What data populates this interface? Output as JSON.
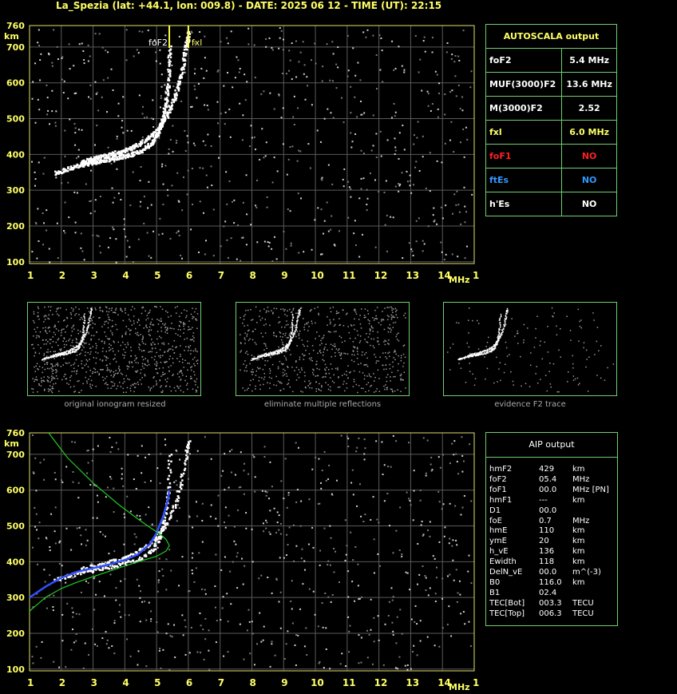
{
  "header": {
    "title": "La_Spezia (lat: +44.1, lon: 009.8) - DATE: 2025 06 12 - TIME (UT): 22:15"
  },
  "axis": {
    "y_unit": "km",
    "x_unit": "MHz",
    "y_ticks": [
      "760",
      "700",
      "600",
      "500",
      "400",
      "300",
      "200",
      "100"
    ],
    "x_ticks": [
      "1",
      "2",
      "3",
      "4",
      "5",
      "6",
      "7",
      "8",
      "9",
      "10",
      "11",
      "12",
      "13",
      "14",
      "15"
    ]
  },
  "markers": {
    "fof2_label": "foF2",
    "fxl_label": "fxl"
  },
  "autoscala": {
    "title": "AUTOSCALA output",
    "rows": [
      {
        "label": "foF2",
        "value": "5.4 MHz",
        "label_color": "#ffffff",
        "value_color": "#ffffff"
      },
      {
        "label": "MUF(3000)F2",
        "value": "13.6 MHz",
        "label_color": "#ffffff",
        "value_color": "#ffffff"
      },
      {
        "label": "M(3000)F2",
        "value": "2.52",
        "label_color": "#ffffff",
        "value_color": "#ffffff"
      },
      {
        "label": "fxl",
        "value": "6.0 MHz",
        "label_color": "#ffff66",
        "value_color": "#ffff66"
      },
      {
        "label": "foF1",
        "value": "NO",
        "label_color": "#ff2020",
        "value_color": "#ff2020"
      },
      {
        "label": "ftEs",
        "value": "NO",
        "label_color": "#3399ff",
        "value_color": "#3399ff"
      },
      {
        "label": "h'Es",
        "value": "NO",
        "label_color": "#ffffff",
        "value_color": "#ffffff"
      }
    ]
  },
  "thumbnails": [
    {
      "caption": "original ionogram resized"
    },
    {
      "caption": "eliminate multiple reflections"
    },
    {
      "caption": "evidence F2 trace"
    }
  ],
  "aip": {
    "title": "AIP output",
    "rows": [
      {
        "name": "hmF2",
        "value": "429",
        "unit": "km"
      },
      {
        "name": "foF2",
        "value": "05.4",
        "unit": "MHz"
      },
      {
        "name": "foF1",
        "value": "00.0",
        "unit": "MHz   [PN]"
      },
      {
        "name": "hmF1",
        "value": "---",
        "unit": "km"
      },
      {
        "name": "D1",
        "value": "00.0",
        "unit": ""
      },
      {
        "name": "foE",
        "value": "0.7",
        "unit": "MHz"
      },
      {
        "name": "hmE",
        "value": "110",
        "unit": "km"
      },
      {
        "name": "ymE",
        "value": "20",
        "unit": "km"
      },
      {
        "name": "h_vE",
        "value": "136",
        "unit": "km"
      },
      {
        "name": "Ewidth",
        "value": "118",
        "unit": "km"
      },
      {
        "name": "DelN_vE",
        "value": "00.0",
        "unit": "m^(-3)"
      },
      {
        "name": "B0",
        "value": "116.0",
        "unit": "km"
      },
      {
        "name": "B1",
        "value": "02.4",
        "unit": ""
      },
      {
        "name": "TEC[Bot]",
        "value": "003.3",
        "unit": "TECU"
      },
      {
        "name": "TEC[Top]",
        "value": "006.3",
        "unit": "TECU"
      }
    ]
  },
  "chart_data": [
    {
      "type": "scatter",
      "title": "",
      "xlabel": "MHz",
      "ylabel": "km",
      "xlim": [
        1,
        15
      ],
      "ylim": [
        95,
        760
      ],
      "grid": true,
      "series": [
        {
          "x": [
            1.8,
            2.2,
            2.6,
            3.0,
            3.4,
            3.8,
            4.2,
            4.6,
            4.9,
            5.1,
            5.25,
            5.35,
            5.4
          ],
          "y": [
            350,
            362,
            372,
            380,
            387,
            394,
            402,
            416,
            440,
            475,
            530,
            600,
            700
          ]
        },
        {
          "x": [
            2.6,
            3.0,
            3.4,
            3.8,
            4.2,
            4.6,
            5.0,
            5.3,
            5.55,
            5.75,
            5.9,
            6.0
          ],
          "y": [
            380,
            390,
            398,
            408,
            420,
            440,
            470,
            510,
            560,
            620,
            700,
            740
          ]
        }
      ],
      "markers": [
        {
          "x": 5.4
        },
        {
          "x": 6.0
        }
      ]
    },
    {
      "type": "line",
      "title": "",
      "xlabel": "MHz",
      "ylabel": "km",
      "xlim": [
        1,
        15
      ],
      "ylim": [
        95,
        760
      ],
      "grid": true,
      "series": [
        {
          "x": [
            1.0,
            1.5,
            2.0,
            2.5,
            3.0,
            3.5,
            4.0,
            4.4,
            4.8,
            5.0,
            5.2,
            5.35,
            5.4
          ],
          "y": [
            300,
            330,
            355,
            372,
            382,
            392,
            405,
            420,
            450,
            480,
            525,
            570,
            600
          ]
        },
        {
          "x": [
            1.6,
            2.2,
            3.0,
            3.8,
            4.4,
            4.8,
            5.1,
            5.3,
            5.4,
            5.3,
            5.0,
            4.5,
            4.0,
            3.5,
            3.0,
            2.5,
            2.0,
            1.5,
            1.0
          ],
          "y": [
            760,
            690,
            620,
            560,
            520,
            495,
            478,
            462,
            445,
            430,
            415,
            402,
            388,
            373,
            358,
            343,
            325,
            300,
            262
          ]
        }
      ]
    }
  ]
}
